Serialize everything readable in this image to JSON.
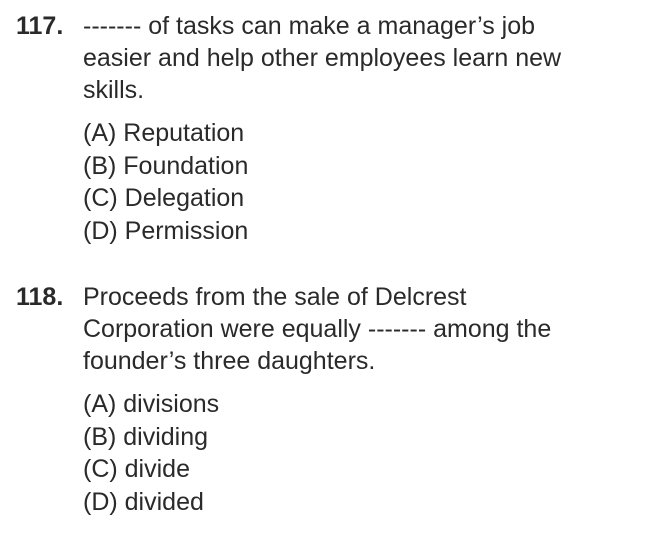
{
  "questions": [
    {
      "number": "117.",
      "stem_lines": [
        "------- of tasks can make a manager’s job",
        "easier and help other employees learn new",
        "skills."
      ],
      "options": [
        "(A) Reputation",
        "(B) Foundation",
        "(C) Delegation",
        "(D) Permission"
      ]
    },
    {
      "number": "118.",
      "stem_lines": [
        "Proceeds from the sale of Delcrest",
        "Corporation were equally ------- among the",
        "founder’s three daughters."
      ],
      "options": [
        "(A) divisions",
        "(B) dividing",
        "(C) divide",
        "(D) divided"
      ]
    }
  ]
}
